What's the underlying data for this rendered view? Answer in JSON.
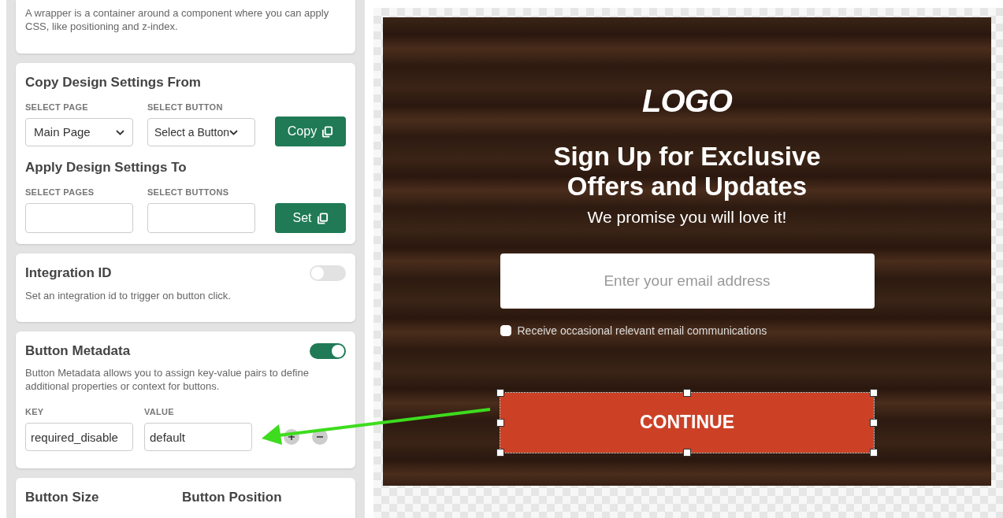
{
  "wrapper_card": {
    "description": "A wrapper is a container around a component where you can apply CSS, like positioning and z-index."
  },
  "copy_settings": {
    "title": "Copy Design Settings From",
    "page_label": "SELECT PAGE",
    "page_value": "Main Page",
    "button_label": "SELECT BUTTON",
    "button_value": "Select a Button",
    "action": "Copy"
  },
  "apply_settings": {
    "title": "Apply Design Settings To",
    "pages_label": "SELECT PAGES",
    "buttons_label": "SELECT BUTTONS",
    "action": "Set"
  },
  "integration": {
    "title": "Integration ID",
    "on": false,
    "description": "Set an integration id to trigger on button click."
  },
  "metadata": {
    "title": "Button Metadata",
    "on": true,
    "description": "Button Metadata allows you to assign key-value pairs to define additional properties or context for buttons.",
    "key_label": "KEY",
    "value_label": "VALUE",
    "key": "required_disable",
    "value": "default"
  },
  "size_position": {
    "size_title": "Button Size",
    "position_title": "Button Position"
  },
  "preview": {
    "logo": "LOGO",
    "heading": "Sign Up for Exclusive Offers and Updates",
    "subheading": "We promise you will love it!",
    "email_placeholder": "Enter your email address",
    "consent": {
      "label": "Receive occasional relevant email communications",
      "checked": false
    },
    "button": {
      "label": "CONTINUE",
      "selected": true
    }
  }
}
